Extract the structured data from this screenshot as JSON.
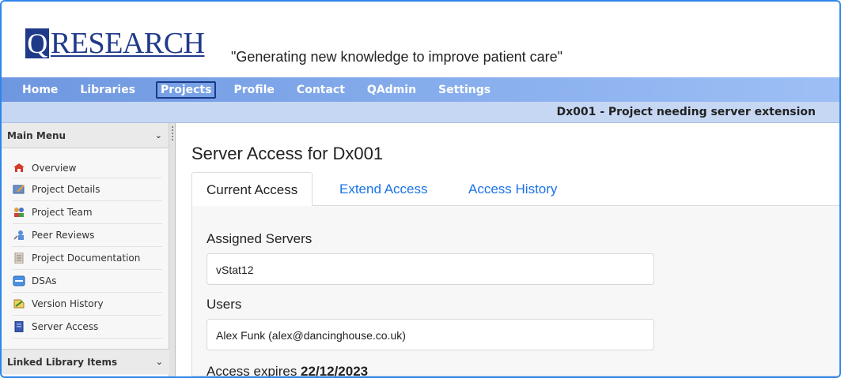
{
  "header": {
    "logo_q": "Q",
    "logo_rest": "RESEARCH",
    "tagline": "\"Generating new knowledge to improve patient care\""
  },
  "nav": {
    "items": [
      {
        "label": "Home"
      },
      {
        "label": "Libraries"
      },
      {
        "label": "Projects"
      },
      {
        "label": "Profile"
      },
      {
        "label": "Contact"
      },
      {
        "label": "QAdmin"
      },
      {
        "label": "Settings"
      }
    ],
    "active": "Projects"
  },
  "subbar": {
    "project_title": "Dx001 - Project needing server extension"
  },
  "sidebar": {
    "main_menu_label": "Main Menu",
    "items": [
      {
        "label": "Overview",
        "icon": "overview-icon"
      },
      {
        "label": "Project Details",
        "icon": "project-details-icon"
      },
      {
        "label": "Project Team",
        "icon": "project-team-icon"
      },
      {
        "label": "Peer Reviews",
        "icon": "peer-reviews-icon"
      },
      {
        "label": "Project Documentation",
        "icon": "documentation-icon"
      },
      {
        "label": "DSAs",
        "icon": "dsas-icon"
      },
      {
        "label": "Version History",
        "icon": "version-history-icon"
      },
      {
        "label": "Server Access",
        "icon": "server-access-icon"
      }
    ],
    "linked_label": "Linked Library Items"
  },
  "main": {
    "title": "Server Access for Dx001",
    "tabs": [
      {
        "label": "Current Access"
      },
      {
        "label": "Extend Access"
      },
      {
        "label": "Access History"
      }
    ],
    "assigned_servers_label": "Assigned Servers",
    "assigned_servers_value": "vStat12",
    "users_label": "Users",
    "users_value": "Alex Funk (alex@dancinghouse.co.uk)",
    "expires_prefix": "Access expires ",
    "expires_date": "22/12/2023"
  },
  "colors": {
    "nav_bar": "#7fa5ea",
    "sub_bar": "#c6d7f4",
    "logo_blue": "#203a8a",
    "link_blue": "#1a73e8",
    "frame_border": "#2e86e8"
  }
}
